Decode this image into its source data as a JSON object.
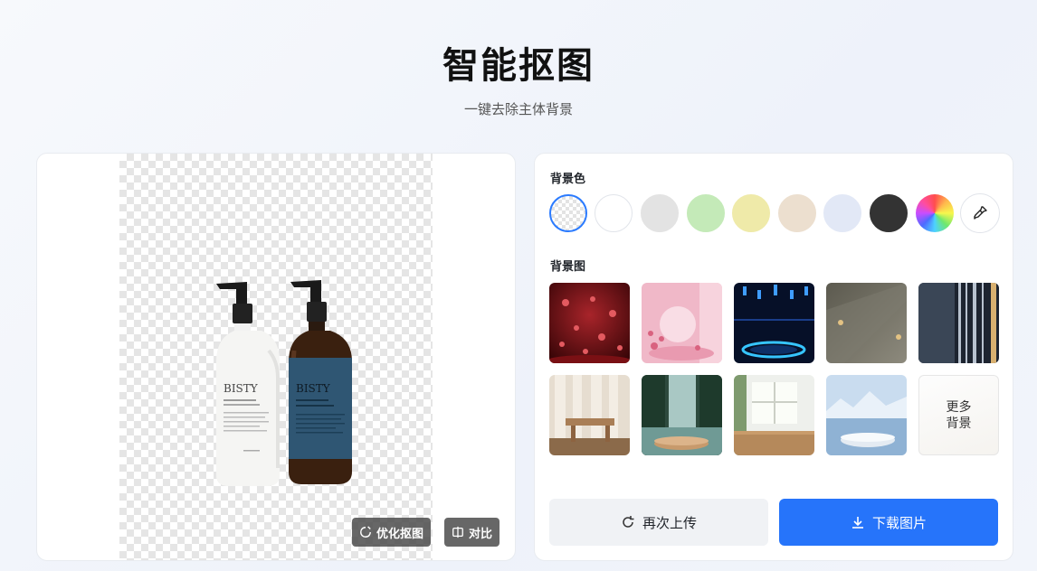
{
  "header": {
    "title": "智能抠图",
    "subtitle": "一键去除主体背景"
  },
  "preview": {
    "product_label_text": "BISTY",
    "optimize_button": "优化抠图",
    "compare_button": "对比"
  },
  "panel": {
    "background_color_label": "背景色",
    "background_colors": [
      {
        "name": "transparent",
        "color": "transparent",
        "selected": true
      },
      {
        "name": "white",
        "color": "#ffffff"
      },
      {
        "name": "light-gray",
        "color": "#e3e3e3"
      },
      {
        "name": "light-green",
        "color": "#c4eab8"
      },
      {
        "name": "light-yellow",
        "color": "#efeaa9"
      },
      {
        "name": "beige",
        "color": "#ecdfcf"
      },
      {
        "name": "light-blue",
        "color": "#e2e8f6"
      },
      {
        "name": "dark-gray",
        "color": "#333333"
      },
      {
        "name": "custom-spectrum",
        "icon": "color-wheel-icon"
      },
      {
        "name": "eyedropper",
        "icon": "eyedropper-icon"
      }
    ],
    "background_image_label": "背景图",
    "background_images": [
      "red-hearts-backdrop",
      "pink-arch-room",
      "blue-neon-stage",
      "gray-wall-lamps",
      "dark-striped-panels",
      "curtain-wooden-stool",
      "forest-waterfall-podium",
      "window-wooden-table",
      "mountain-lake-podium"
    ],
    "more_backgrounds_line1": "更多",
    "more_backgrounds_line2": "背景",
    "reupload_button": "再次上传",
    "download_button": "下载图片"
  },
  "colors": {
    "accent": "#2674fa",
    "selected_border": "#2b7bff"
  }
}
